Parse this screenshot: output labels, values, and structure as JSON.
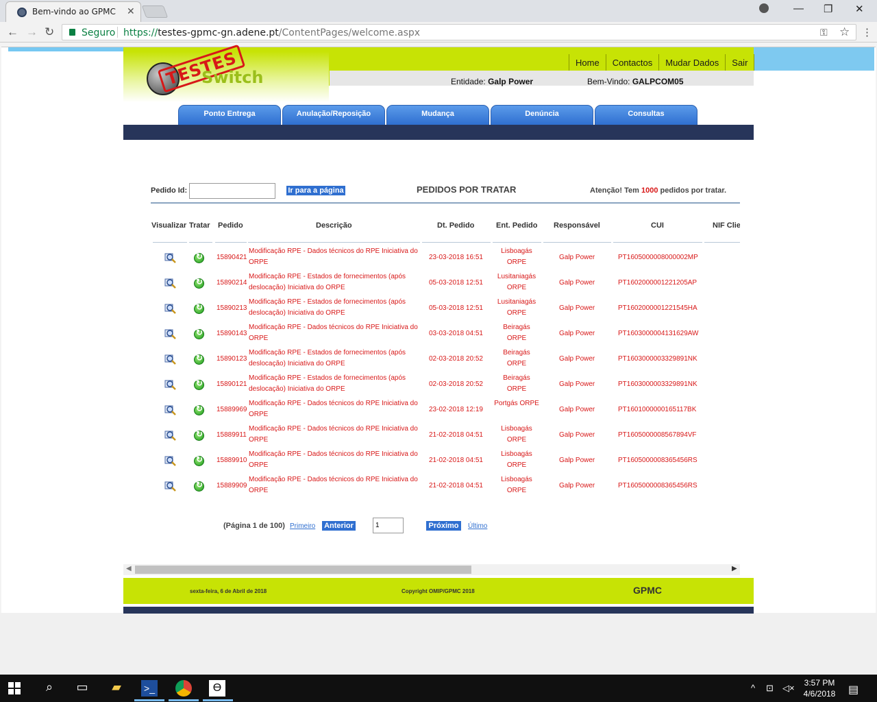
{
  "browser": {
    "tab_title": "Bem-vindo ao GPMC",
    "tab_close": "✕",
    "secure_label": "Seguro",
    "url_scheme": "https://",
    "url_host": "testes-gpmc-gn.adene.pt",
    "url_path": "/ContentPages/welcome.aspx",
    "back_icon": "arrow-left-icon",
    "forward_icon": "arrow-right-icon",
    "reload_icon": "reload-icon",
    "minimize": "—",
    "maximize": "❐",
    "close": "✕"
  },
  "header": {
    "logo_stamp": "TESTES",
    "logo_word": "Switch",
    "links": [
      "Home",
      "Contactos",
      "Mudar Dados",
      "Sair"
    ],
    "entity_label": "Entidade:",
    "entity_value": "Galp Power",
    "welcome_label": "Bem-Vindo:",
    "welcome_value": "GALPCOM05"
  },
  "menu": [
    "Ponto Entrega",
    "Anulação/Reposição",
    "Mudança",
    "Denúncia",
    "Consultas"
  ],
  "search": {
    "label": "Pedido Id:",
    "value": "",
    "button": "Ir para a página"
  },
  "section_title": "PEDIDOS POR TRATAR",
  "attention": {
    "prefix": "Atenção! Tem",
    "count": "1000",
    "suffix": "pedidos por tratar."
  },
  "table": {
    "headers": [
      "Visualizar",
      "Tratar",
      "Pedido",
      "Descrição",
      "Dt. Pedido",
      "Ent. Pedido",
      "Responsável",
      "CUI",
      "NIF Clie"
    ],
    "rows": [
      {
        "pedido": "15890421",
        "desc1": "Modificação RPE - Dados técnicos do RPE Iniciativa do",
        "desc2": "ORPE",
        "date": "23-03-2018 16:51",
        "ent1": "Lisboagás",
        "ent2": "ORPE",
        "resp": "Galp Power",
        "cui": "PT1605000008000002MP"
      },
      {
        "pedido": "15890214",
        "desc1": "Modificação RPE - Estados de fornecimentos (após",
        "desc2": "deslocação) Iniciativa do ORPE",
        "date": "05-03-2018 12:51",
        "ent1": "Lusitaniagás",
        "ent2": "ORPE",
        "resp": "Galp Power",
        "cui": "PT1602000001221205AP"
      },
      {
        "pedido": "15890213",
        "desc1": "Modificação RPE - Estados de fornecimentos (após",
        "desc2": "deslocação) Iniciativa do ORPE",
        "date": "05-03-2018 12:51",
        "ent1": "Lusitaniagás",
        "ent2": "ORPE",
        "resp": "Galp Power",
        "cui": "PT1602000001221545HA"
      },
      {
        "pedido": "15890143",
        "desc1": "Modificação RPE - Dados técnicos do RPE Iniciativa do",
        "desc2": "ORPE",
        "date": "03-03-2018 04:51",
        "ent1": "Beiragás",
        "ent2": "ORPE",
        "resp": "Galp Power",
        "cui": "PT1603000004131629AW"
      },
      {
        "pedido": "15890123",
        "desc1": "Modificação RPE - Estados de fornecimentos (após",
        "desc2": "deslocação) Iniciativa do ORPE",
        "date": "02-03-2018 20:52",
        "ent1": "Beiragás",
        "ent2": "ORPE",
        "resp": "Galp Power",
        "cui": "PT1603000003329891NK"
      },
      {
        "pedido": "15890121",
        "desc1": "Modificação RPE - Estados de fornecimentos (após",
        "desc2": "deslocação) Iniciativa do ORPE",
        "date": "02-03-2018 20:52",
        "ent1": "Beiragás",
        "ent2": "ORPE",
        "resp": "Galp Power",
        "cui": "PT1603000003329891NK"
      },
      {
        "pedido": "15889969",
        "desc1": "Modificação RPE - Dados técnicos do RPE Iniciativa do",
        "desc2": "ORPE",
        "date": "23-02-2018 12:19",
        "ent1": "Portgás ORPE",
        "ent2": "",
        "resp": "Galp Power",
        "cui": "PT1601000000165117BK"
      },
      {
        "pedido": "15889911",
        "desc1": "Modificação RPE - Dados técnicos do RPE Iniciativa do",
        "desc2": "ORPE",
        "date": "21-02-2018 04:51",
        "ent1": "Lisboagás",
        "ent2": "ORPE",
        "resp": "Galp Power",
        "cui": "PT1605000008567894VF"
      },
      {
        "pedido": "15889910",
        "desc1": "Modificação RPE - Dados técnicos do RPE Iniciativa do",
        "desc2": "ORPE",
        "date": "21-02-2018 04:51",
        "ent1": "Lisboagás",
        "ent2": "ORPE",
        "resp": "Galp Power",
        "cui": "PT1605000008365456RS"
      },
      {
        "pedido": "15889909",
        "desc1": "Modificação RPE - Dados técnicos do RPE Iniciativa do",
        "desc2": "ORPE",
        "date": "21-02-2018 04:51",
        "ent1": "Lisboagás",
        "ent2": "ORPE",
        "resp": "Galp Power",
        "cui": "PT1605000008365456RS"
      }
    ]
  },
  "pager": {
    "label": "(Página 1 de 100)",
    "first": "Primeiro",
    "prev": "Anterior",
    "page_value": "1",
    "next": "Próximo",
    "last": "Último"
  },
  "footer": {
    "date": "sexta-feira, 6 de Abril de 2018",
    "copyright": "Copyright OMIP/GPMC 2018",
    "brand": "GPMC"
  },
  "taskbar": {
    "time": "3:57 PM",
    "date": "4/6/2018"
  },
  "colors": {
    "header_green": "#c7e305",
    "menu_blue": "#2f6fd0",
    "dark_navy": "#27355a",
    "row_red": "#d81818"
  }
}
